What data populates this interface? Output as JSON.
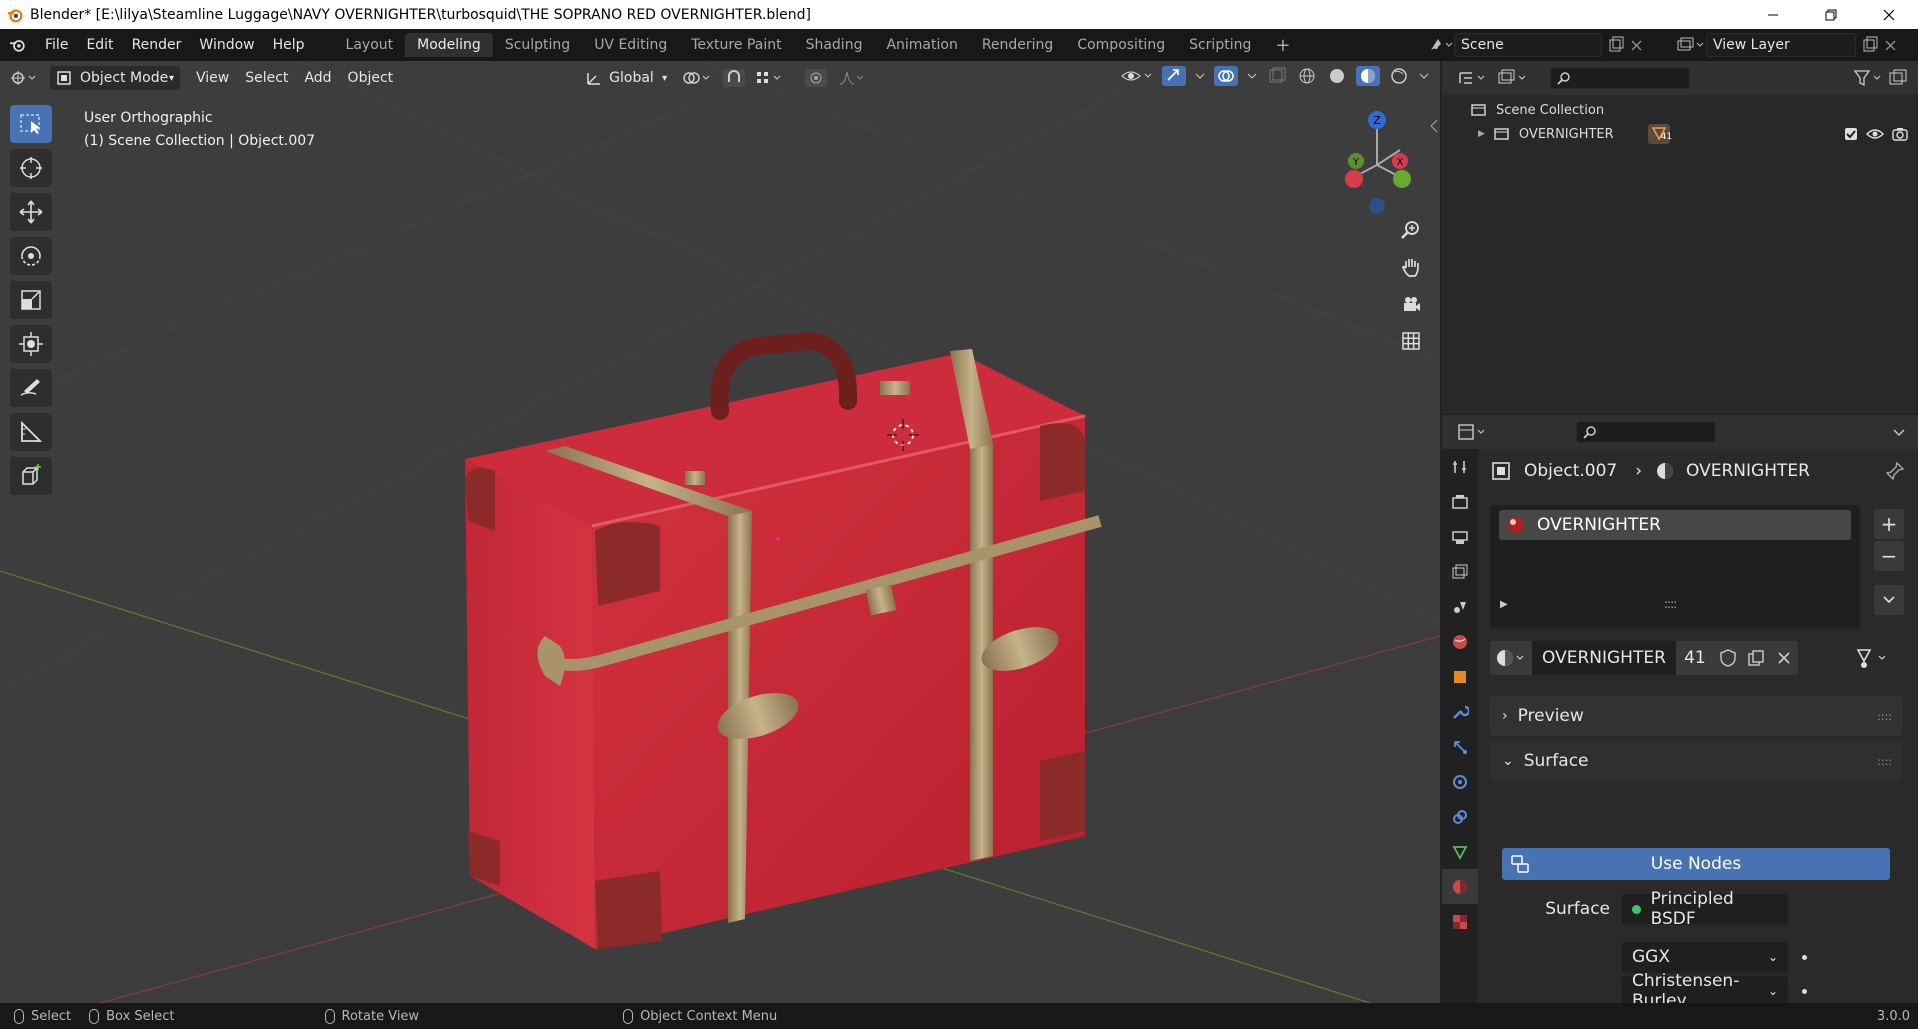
{
  "window": {
    "title": "Blender* [E:\\lilya\\Steamline Luggage\\NAVY OVERNIGHTER\\turbosquid\\THE SOPRANO RED OVERNIGHTER.blend]"
  },
  "menu": [
    "File",
    "Edit",
    "Render",
    "Window",
    "Help"
  ],
  "workspaces": [
    {
      "label": "Layout",
      "active": false
    },
    {
      "label": "Modeling",
      "active": true
    },
    {
      "label": "Sculpting",
      "active": false
    },
    {
      "label": "UV Editing",
      "active": false
    },
    {
      "label": "Texture Paint",
      "active": false
    },
    {
      "label": "Shading",
      "active": false
    },
    {
      "label": "Animation",
      "active": false
    },
    {
      "label": "Rendering",
      "active": false
    },
    {
      "label": "Compositing",
      "active": false
    },
    {
      "label": "Scripting",
      "active": false
    }
  ],
  "scene": {
    "name": "Scene",
    "view_layer": "View Layer"
  },
  "viewport": {
    "mode": "Object Mode",
    "menus": [
      "View",
      "Select",
      "Add",
      "Object"
    ],
    "orientation": "Global",
    "view_name": "User Orthographic",
    "context": "(1) Scene Collection | Object.007",
    "gizmo": {
      "z": "Z",
      "y": "Y",
      "x": "X"
    }
  },
  "outliner": {
    "root": "Scene Collection",
    "items": [
      {
        "name": "OVERNIGHTER",
        "badge": "41"
      }
    ]
  },
  "properties": {
    "object": "Object.007",
    "material": "OVERNIGHTER",
    "slot": "OVERNIGHTER",
    "material_field": "OVERNIGHTER",
    "users": "41",
    "preview_label": "Preview",
    "surface_label": "Surface",
    "use_nodes": "Use Nodes",
    "surface_field_label": "Surface",
    "surface_shader": "Principled BSDF",
    "distribution": "GGX",
    "subsurface_method": "Christensen-Burley"
  },
  "status": {
    "items": [
      "Select",
      "Box Select",
      "Rotate View",
      "Object Context Menu"
    ],
    "version": "3.0.0"
  }
}
